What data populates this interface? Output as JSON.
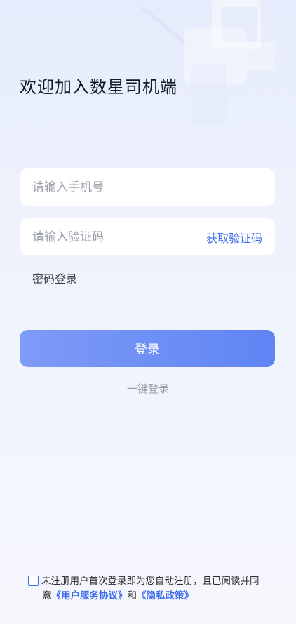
{
  "welcome_title": "欢迎加入数星司机端",
  "phone_field": {
    "placeholder": "请输入手机号",
    "value": ""
  },
  "code_field": {
    "placeholder": "请输入验证码",
    "value": "",
    "get_code_label": "获取验证码"
  },
  "password_login_label": "密码登录",
  "login_button_label": "登录",
  "one_click_login_label": "一键登录",
  "agreement": {
    "checked": false,
    "text_line1": "未注册用户首次登录即为您自动注册，且已阅读并同",
    "text_prefix": "意",
    "user_agreement_link": "《用户服务协议》",
    "conjunction": "和",
    "privacy_link": "《隐私政策》"
  },
  "colors": {
    "accent": "#3b6cf0",
    "button_start": "#7e9bf6",
    "button_end": "#5f84f4",
    "background": "#eef2fc"
  }
}
